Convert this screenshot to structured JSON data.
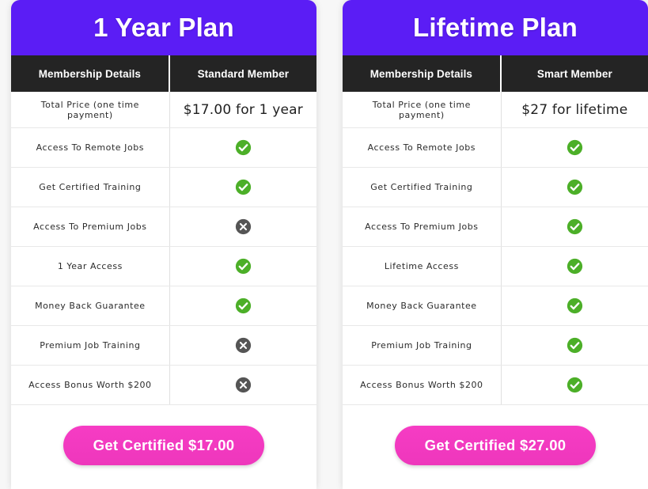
{
  "theme": {
    "page_background": "#f7f7f7",
    "header_purple": "#5B1DF5",
    "column_header_dark": "#242424",
    "cta_pink": "#F23FC0",
    "check_green": "#4CAF28",
    "cross_gray": "#555555"
  },
  "column_headers": {
    "features": "Membership Details"
  },
  "plans": [
    {
      "title": "1 Year Plan",
      "member_label": "Standard Member",
      "price_label": "Total Price (one time payment)",
      "price_value": "$17.00 for 1 year",
      "cta_label": "Get Certified $17.00",
      "features": [
        {
          "label": "Access To Remote Jobs",
          "icon": "check-icon",
          "included": true
        },
        {
          "label": "Get Certified Training",
          "icon": "check-icon",
          "included": true
        },
        {
          "label": "Access To Premium Jobs",
          "icon": "cross-icon",
          "included": false
        },
        {
          "label": "1 Year Access",
          "icon": "check-icon",
          "included": true
        },
        {
          "label": "Money Back Guarantee",
          "icon": "check-icon",
          "included": true
        },
        {
          "label": "Premium Job Training",
          "icon": "cross-icon",
          "included": false
        },
        {
          "label": "Access Bonus Worth $200",
          "icon": "cross-icon",
          "included": false
        }
      ]
    },
    {
      "title": "Lifetime Plan",
      "member_label": "Smart Member",
      "price_label": "Total Price (one time payment)",
      "price_value": "$27 for lifetime",
      "cta_label": "Get Certified $27.00",
      "features": [
        {
          "label": "Access To Remote Jobs",
          "icon": "check-icon",
          "included": true
        },
        {
          "label": "Get Certified Training",
          "icon": "check-icon",
          "included": true
        },
        {
          "label": "Access To Premium Jobs",
          "icon": "check-icon",
          "included": true
        },
        {
          "label": "Lifetime Access",
          "icon": "check-icon",
          "included": true
        },
        {
          "label": "Money Back Guarantee",
          "icon": "check-icon",
          "included": true
        },
        {
          "label": "Premium Job Training",
          "icon": "check-icon",
          "included": true
        },
        {
          "label": "Access Bonus Worth $200",
          "icon": "check-icon",
          "included": true
        }
      ]
    }
  ]
}
